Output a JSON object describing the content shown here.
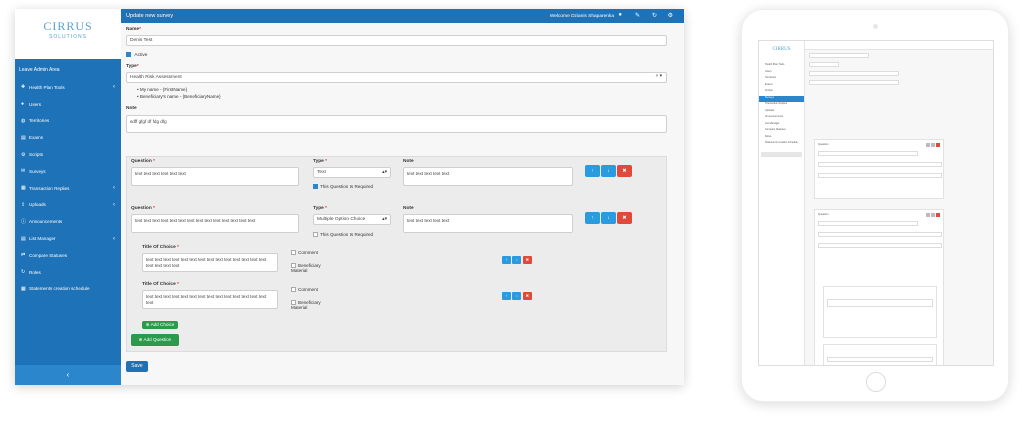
{
  "sidebar": {
    "logo_name": "CIRRUS",
    "logo_sub": "SOLUTIONS",
    "leave": "Leave Admin Area",
    "items": [
      {
        "label": "Health Plan Tools",
        "icon": "plus-icon",
        "chevron": true
      },
      {
        "label": "Users",
        "icon": "user-icon",
        "chevron": false
      },
      {
        "label": "Territories",
        "icon": "globe-icon",
        "chevron": false
      },
      {
        "label": "Exams",
        "icon": "list-icon",
        "chevron": false
      },
      {
        "label": "Scripts",
        "icon": "gear-icon",
        "chevron": false
      },
      {
        "label": "Surveys",
        "icon": "chat-icon",
        "chevron": false
      },
      {
        "label": "Transaction Replies",
        "icon": "table-icon",
        "chevron": true
      },
      {
        "label": "Uploads",
        "icon": "upload-icon",
        "chevron": true
      },
      {
        "label": "Announcements",
        "icon": "info-icon",
        "chevron": false
      },
      {
        "label": "List Manager",
        "icon": "list-icon",
        "chevron": true
      },
      {
        "label": "Compare Statuses",
        "icon": "compare-icon",
        "chevron": false
      },
      {
        "label": "Roles",
        "icon": "refresh-icon",
        "chevron": false
      },
      {
        "label": "Statements creation schedule",
        "icon": "calendar-icon",
        "chevron": false
      }
    ],
    "collapse": "‹"
  },
  "topbar": {
    "title": "Update new survey",
    "welcome": "Welcome Dzianis Shaparenka"
  },
  "form": {
    "name_label": "Name",
    "name_value": "Denis Test",
    "active_label": "Active",
    "type_label": "Type",
    "type_value": "Health Risk Assessment",
    "hints": [
      "My name - {FirstName}",
      "Beneficiary's name - {BeneficiaryName}"
    ],
    "note_label": "Note",
    "note_value": "sdff gfgf df fdg dfg",
    "save": "Save"
  },
  "questions": [
    {
      "question_label": "Question",
      "question_text": "text text text text text text",
      "type_label": "Type",
      "type_value": "Text",
      "required_label": "This Question Is Required",
      "required_checked": true,
      "note_label": "Note",
      "note_value": "text text text text text"
    },
    {
      "question_label": "Question",
      "question_text": "text text text text text text text text text text text text text text",
      "type_label": "Type",
      "type_value": "Multiple Option Choice",
      "required_label": "This Question Is Required",
      "required_checked": false,
      "note_label": "Note",
      "note_value": "text text text text text"
    }
  ],
  "choices": [
    {
      "title_label": "Title Of Choice",
      "text": "text text text text text text text text text text text text text text text text text text",
      "comment_label": "Comment",
      "beneficiary_label": "Beneficiary Material"
    },
    {
      "title_label": "Title Of Choice",
      "text": "text text text text text text text text text text text text text text text",
      "comment_label": "Comment",
      "beneficiary_label": "Beneficiary Material"
    }
  ],
  "buttons": {
    "add_choice": "Add Choice",
    "add_question": "Add Question"
  }
}
